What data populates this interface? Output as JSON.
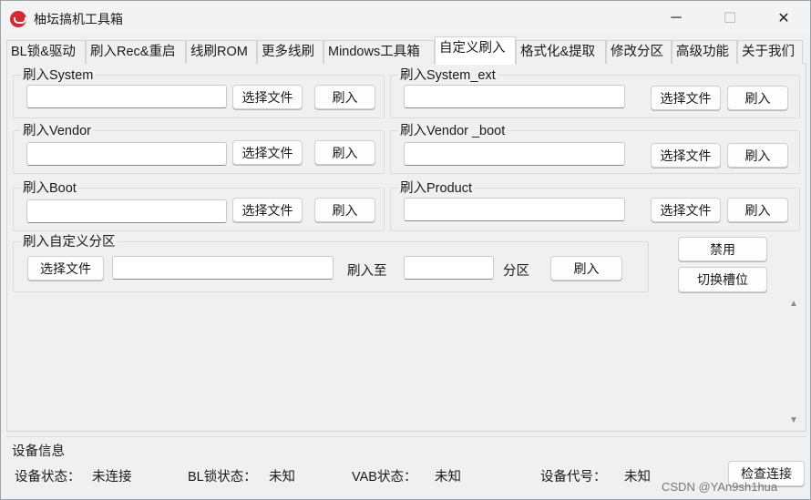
{
  "window": {
    "title": "柚坛搞机工具箱",
    "minimize": "─",
    "maximize": "☐",
    "close": "✕"
  },
  "tabs": [
    "BL锁&驱动",
    "刷入Rec&重启",
    "线刷ROM",
    "更多线刷",
    "Mindows工具箱",
    "自定义刷入",
    "格式化&提取",
    "修改分区",
    "高级功能",
    "关于我们"
  ],
  "active_tab": "自定义刷入",
  "groups": {
    "system": {
      "label": "刷入System",
      "value": "",
      "select": "选择文件",
      "flash": "刷入"
    },
    "system_ext": {
      "label": "刷入System_ext",
      "value": "",
      "select": "选择文件",
      "flash": "刷入"
    },
    "vendor": {
      "label": "刷入Vendor",
      "value": "",
      "select": "选择文件",
      "flash": "刷入"
    },
    "vendor_boot": {
      "label": "刷入Vendor _boot",
      "value": "",
      "select": "选择文件",
      "flash": "刷入"
    },
    "boot": {
      "label": "刷入Boot",
      "value": "",
      "select": "选择文件",
      "flash": "刷入"
    },
    "product": {
      "label": "刷入Product",
      "value": "",
      "select": "选择文件",
      "flash": "刷入"
    }
  },
  "custom_partition": {
    "label": "刷入自定义分区",
    "select": "选择文件",
    "file_value": "",
    "flash_to": "刷入至",
    "partition_value": "",
    "partition": "分区",
    "flash": "刷入"
  },
  "side_buttons": {
    "disable": "禁用",
    "switch_slot": "切换槽位"
  },
  "device_info": {
    "title": "设备信息",
    "status_label": "设备状态：",
    "status_value": "未连接",
    "bl_label": "BL锁状态：",
    "bl_value": "未知",
    "vab_label": "VAB状态：",
    "vab_value": "未知",
    "code_label": "设备代号：",
    "code_value": "未知",
    "check_button": "检查连接"
  },
  "watermark": "CSDN @YAn9sh1hua"
}
